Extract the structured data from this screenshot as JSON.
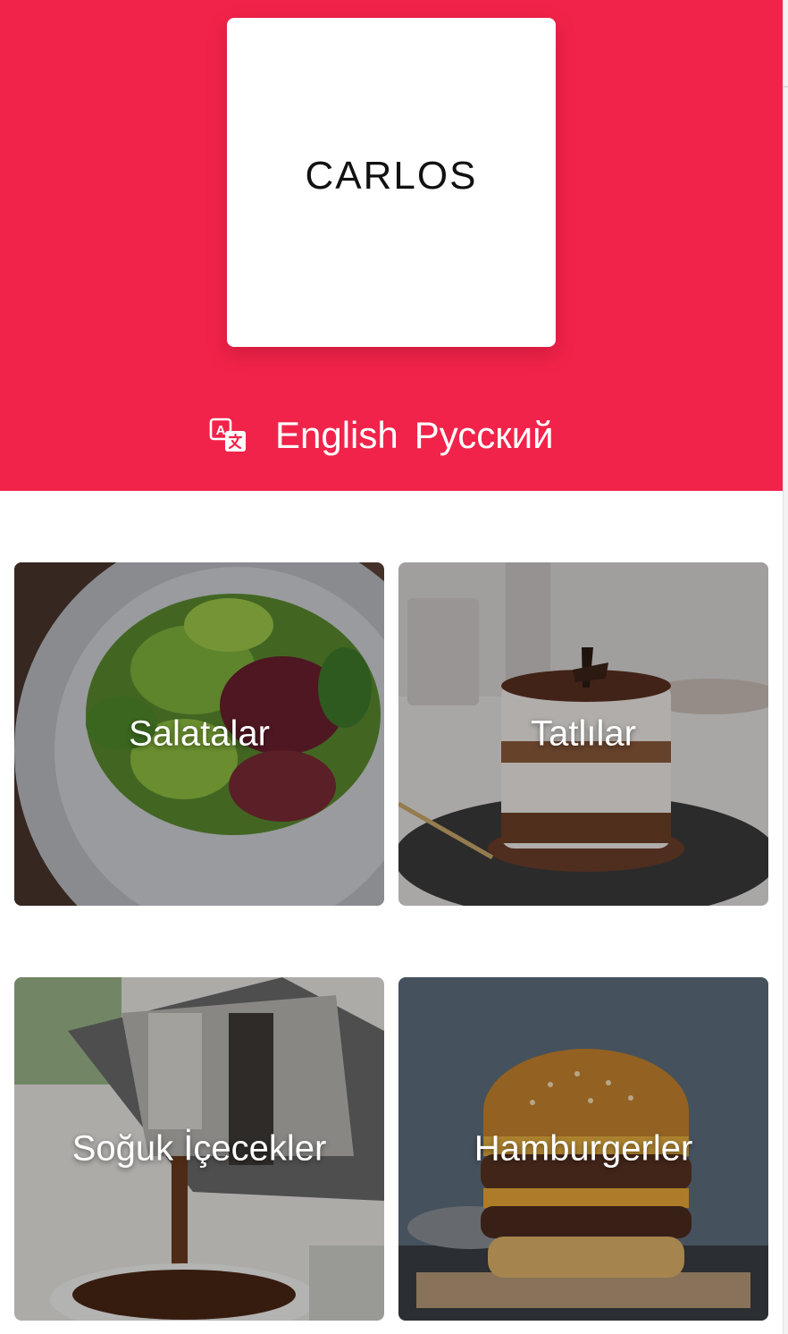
{
  "brand": {
    "logo_text": "CARLOS",
    "header_color": "#f2234a"
  },
  "languages": {
    "icon": "translate-icon",
    "options": [
      "English",
      "Русский"
    ]
  },
  "categories": [
    {
      "label": "Salatalar",
      "image": "salad-bowl-photo"
    },
    {
      "label": "Tatlılar",
      "image": "tiramisu-dessert-photo"
    },
    {
      "label": "Soğuk İçecekler",
      "image": "cold-brew-coffee-photo"
    },
    {
      "label": "Hamburgerler",
      "image": "hamburger-photo"
    }
  ]
}
